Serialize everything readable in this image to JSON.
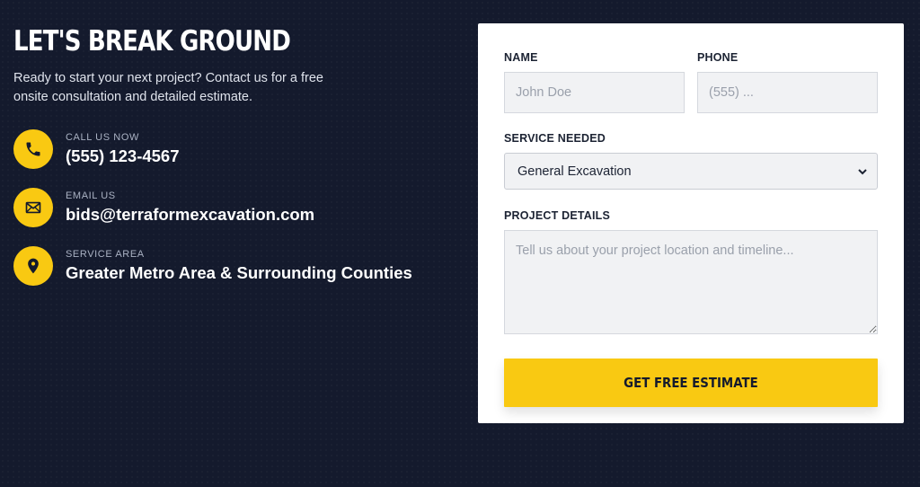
{
  "hero": {
    "heading": "LET'S BREAK GROUND",
    "intro": "Ready to start your next project? Contact us for a free onsite consultation and detailed estimate."
  },
  "contacts": [
    {
      "label": "CALL US NOW",
      "value": "(555) 123-4567",
      "icon": "phone-icon"
    },
    {
      "label": "EMAIL US",
      "value": "bids@terraformexcavation.com",
      "icon": "mail-icon"
    },
    {
      "label": "SERVICE AREA",
      "value": "Greater Metro Area & Surrounding Counties",
      "icon": "map-pin-icon"
    }
  ],
  "form": {
    "name_label": "NAME",
    "name_placeholder": "John Doe",
    "phone_label": "PHONE",
    "phone_placeholder": "(555) ...",
    "service_label": "SERVICE NEEDED",
    "service_selected": "General Excavation",
    "details_label": "PROJECT DETAILS",
    "details_placeholder": "Tell us about your project location and timeline...",
    "submit_label": "GET FREE ESTIMATE"
  },
  "colors": {
    "background": "#141a2d",
    "accent": "#f9c912",
    "card": "#ffffff"
  }
}
